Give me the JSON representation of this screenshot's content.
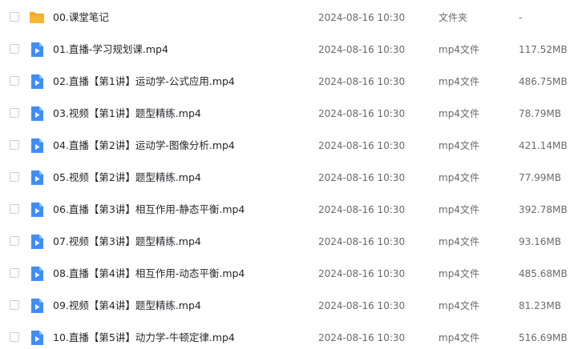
{
  "files": [
    {
      "name": "00.课堂笔记",
      "date": "2024-08-16 10:30",
      "type": "文件夹",
      "size": "-",
      "icon": "folder-icon"
    },
    {
      "name": "01.直播-学习规划课.mp4",
      "date": "2024-08-16 10:30",
      "type": "mp4文件",
      "size": "117.52MB",
      "icon": "video-file-icon"
    },
    {
      "name": "02.直播【第1讲】运动学-公式应用.mp4",
      "date": "2024-08-16 10:30",
      "type": "mp4文件",
      "size": "486.75MB",
      "icon": "video-file-icon"
    },
    {
      "name": "03.视频【第1讲】题型精练.mp4",
      "date": "2024-08-16 10:30",
      "type": "mp4文件",
      "size": "78.79MB",
      "icon": "video-file-icon"
    },
    {
      "name": "04.直播【第2讲】运动学-图像分析.mp4",
      "date": "2024-08-16 10:30",
      "type": "mp4文件",
      "size": "421.14MB",
      "icon": "video-file-icon"
    },
    {
      "name": "05.视频【第2讲】题型精练.mp4",
      "date": "2024-08-16 10:30",
      "type": "mp4文件",
      "size": "77.99MB",
      "icon": "video-file-icon"
    },
    {
      "name": "06.直播【第3讲】相互作用-静态平衡.mp4",
      "date": "2024-08-16 10:30",
      "type": "mp4文件",
      "size": "392.78MB",
      "icon": "video-file-icon"
    },
    {
      "name": "07.视频【第3讲】题型精练.mp4",
      "date": "2024-08-16 10:30",
      "type": "mp4文件",
      "size": "93.16MB",
      "icon": "video-file-icon"
    },
    {
      "name": "08.直播【第4讲】相互作用-动态平衡.mp4",
      "date": "2024-08-16 10:30",
      "type": "mp4文件",
      "size": "485.68MB",
      "icon": "video-file-icon"
    },
    {
      "name": "09.视频【第4讲】题型精练.mp4",
      "date": "2024-08-16 10:30",
      "type": "mp4文件",
      "size": "81.23MB",
      "icon": "video-file-icon"
    },
    {
      "name": "10.直播【第5讲】动力学-牛顿定律.mp4",
      "date": "2024-08-16 10:30",
      "type": "mp4文件",
      "size": "516.69MB",
      "icon": "video-file-icon"
    }
  ],
  "colors": {
    "folder": "#f7b731",
    "folder_tab": "#f5a623",
    "video": "#3d8ff5"
  }
}
